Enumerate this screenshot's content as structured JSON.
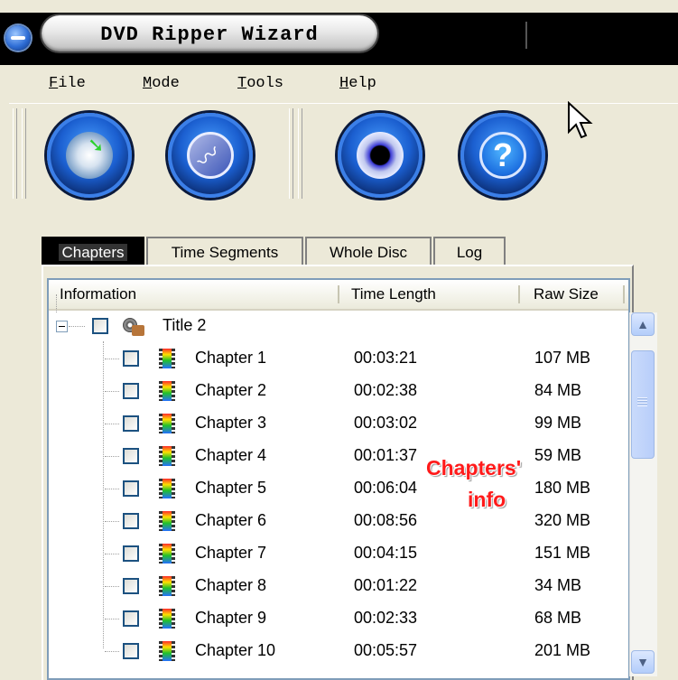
{
  "window": {
    "title": "DVD Ripper Wizard"
  },
  "menubar": {
    "items": [
      {
        "label": "File",
        "mnemonic": "F",
        "rest": "ile"
      },
      {
        "label": "Mode",
        "mnemonic": "M",
        "rest": "ode"
      },
      {
        "label": "Tools",
        "mnemonic": "T",
        "rest": "ools"
      },
      {
        "label": "Help",
        "mnemonic": "H",
        "rest": "elp"
      }
    ]
  },
  "toolbar": {
    "buttons": [
      {
        "icon": "disc-rip-icon"
      },
      {
        "icon": "mode-wave-icon"
      },
      {
        "icon": "settings-disc-icon"
      },
      {
        "icon": "help-question-icon"
      }
    ]
  },
  "tabs": [
    {
      "label": "Chapters",
      "active": true
    },
    {
      "label": "Time Segments",
      "active": false
    },
    {
      "label": "Whole Disc",
      "active": false
    },
    {
      "label": "Log",
      "active": false
    }
  ],
  "list": {
    "columns": [
      "Information",
      "Time Length",
      "Raw Size"
    ],
    "title_row": {
      "label": "Title 2",
      "expanded": true
    },
    "chapters": [
      {
        "name": "Chapter 1",
        "time": "00:03:21",
        "size": "107 MB"
      },
      {
        "name": "Chapter 2",
        "time": "00:02:38",
        "size": "84 MB"
      },
      {
        "name": "Chapter 3",
        "time": "00:03:02",
        "size": "99 MB"
      },
      {
        "name": "Chapter 4",
        "time": "00:01:37",
        "size": "59 MB"
      },
      {
        "name": "Chapter 5",
        "time": "00:06:04",
        "size": "180 MB"
      },
      {
        "name": "Chapter 6",
        "time": "00:08:56",
        "size": "320 MB"
      },
      {
        "name": "Chapter 7",
        "time": "00:04:15",
        "size": "151 MB"
      },
      {
        "name": "Chapter 8",
        "time": "00:01:22",
        "size": "34 MB"
      },
      {
        "name": "Chapter 9",
        "time": "00:02:33",
        "size": "68 MB"
      },
      {
        "name": "Chapter 10",
        "time": "00:05:57",
        "size": "201 MB"
      }
    ]
  },
  "annotation": {
    "line1": "Chapters'",
    "line2": "info",
    "color": "#ff1a1a"
  },
  "colors": {
    "titlebar": "#000000",
    "face": "#ece9d8",
    "list_border": "#7f9db9"
  }
}
